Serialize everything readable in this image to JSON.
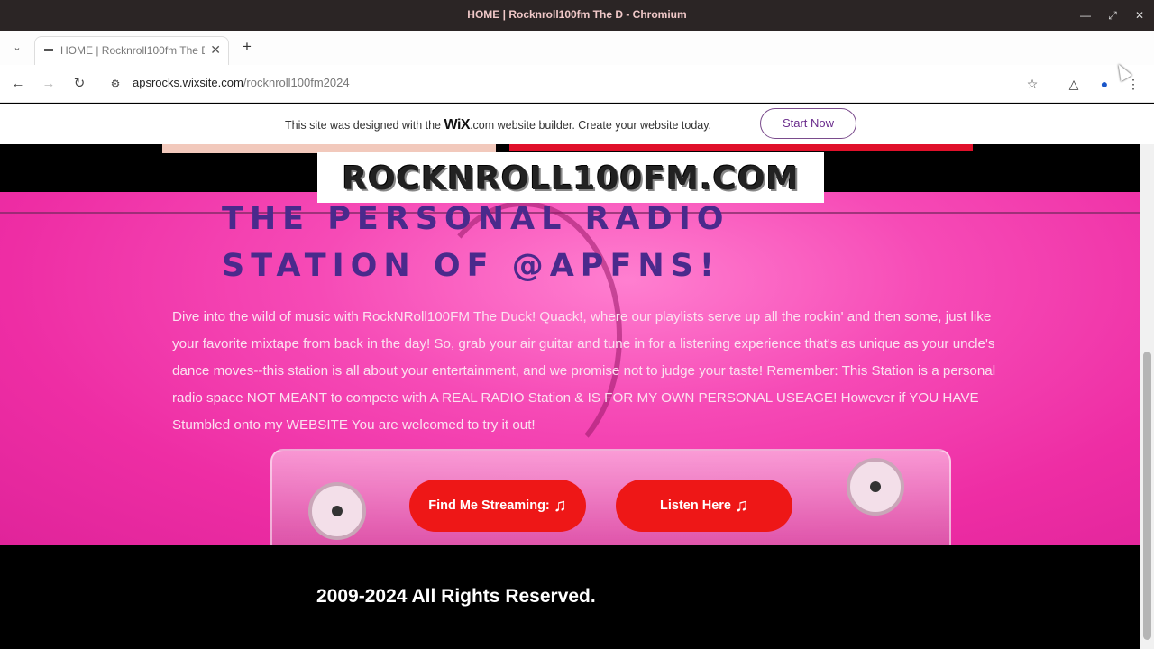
{
  "window": {
    "title": "HOME | Rocknroll100fm The D - Chromium"
  },
  "tabs": [
    {
      "label": "HOME | Rocknroll100fm The D"
    }
  ],
  "toolbar": {
    "url_host": "apsrocks.wixsite.com",
    "url_path": "/rocknroll100fm2024"
  },
  "wix_banner": {
    "text_before": "This site was designed with the ",
    "brand": "WiX",
    "text_after": ".com website builder. Create your website today.",
    "cta_label": "Start Now"
  },
  "page": {
    "logo_text": "ROCKNROLL100FM.COM",
    "heading": "THE PERSONAL RADIO STATION OF @APFNS!",
    "description": "Dive into the wild of music with RockNRoll100FM The Duck! Quack!, where our playlists serve up all the rockin' and then some, just like your favorite mixtape from back in the day! So, grab your air guitar and tune in for a listening experience that's as unique as your uncle's dance moves--this station is all about your entertainment, and we promise not to judge your taste! Remember: This Station is a personal radio space NOT MEANT to compete with A REAL RADIO Station & IS FOR MY OWN PERSONAL USEAGE! However if YOU HAVE Stumbled onto my WEBSITE You are welcomed to try it out!",
    "buttons": {
      "stream_label": "Find Me Streaming:",
      "listen_label": "Listen Here"
    },
    "footer_text": "2009-2024 All Rights Reserved."
  },
  "colors": {
    "hero_pink": "#ee2da4",
    "heading_purple": "#4a2a8c",
    "button_red": "#ee1717",
    "wix_cta_purple": "#6a2c8c"
  }
}
